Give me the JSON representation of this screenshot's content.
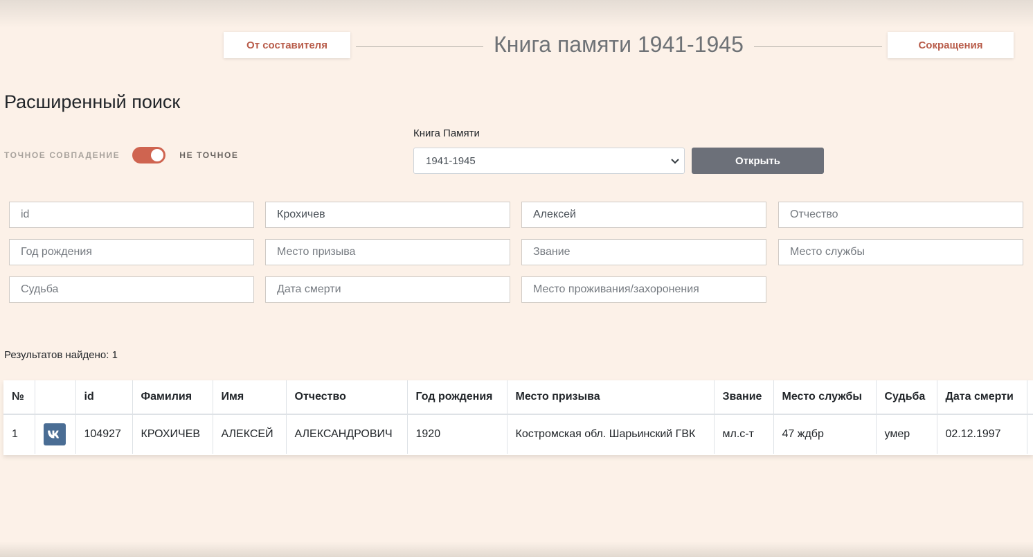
{
  "header": {
    "left_button": "От составителя",
    "title": "Книга памяти 1941-1945",
    "right_button": "Сокращения"
  },
  "search": {
    "title": "Расширенный поиск",
    "exact_label": "ТОЧНОЕ СОВПАДЕНИЕ",
    "inexact_label": "НЕ ТОЧНОЕ",
    "toggle_state": "НЕ ТОЧНОЕ",
    "book_label": "Книга Памяти",
    "book_selected": "1941-1945",
    "open_button": "Открыть"
  },
  "fields": [
    {
      "placeholder": "id",
      "value": ""
    },
    {
      "placeholder": "Фамилия",
      "value": "Крохичев"
    },
    {
      "placeholder": "Имя",
      "value": "Алексей"
    },
    {
      "placeholder": "Отчество",
      "value": ""
    },
    {
      "placeholder": "Год рождения",
      "value": ""
    },
    {
      "placeholder": "Место призыва",
      "value": ""
    },
    {
      "placeholder": "Звание",
      "value": ""
    },
    {
      "placeholder": "Место службы",
      "value": ""
    },
    {
      "placeholder": "Судьба",
      "value": ""
    },
    {
      "placeholder": "Дата смерти",
      "value": ""
    },
    {
      "placeholder": "Место проживания/захоронения",
      "value": ""
    }
  ],
  "results": {
    "count_text": "Результатов найдено: 1",
    "headers": [
      "№",
      "",
      "id",
      "Фамилия",
      "Имя",
      "Отчество",
      "Год рождения",
      "Место призыва",
      "Звание",
      "Место службы",
      "Судьба",
      "Дата смерти",
      ""
    ],
    "rows": [
      {
        "num": "1",
        "share_icon": "vk-icon",
        "id": "104927",
        "surname": "КРОХИЧЕВ",
        "name": "АЛЕКСЕЙ",
        "patronymic": "АЛЕКСАНДРОВИЧ",
        "birth_year": "1920",
        "draft_place": "Костромская обл. Шарьинский ГВК",
        "rank": "мл.с-т",
        "service_place": "47 ждбр",
        "fate": "умер",
        "death_date": "02.12.1997"
      }
    ]
  },
  "colors": {
    "background": "#fcf1e8",
    "accent": "#cf6450",
    "header_link": "#b85c4a",
    "button_gray": "#6c7079",
    "vk": "#4a6d94"
  }
}
